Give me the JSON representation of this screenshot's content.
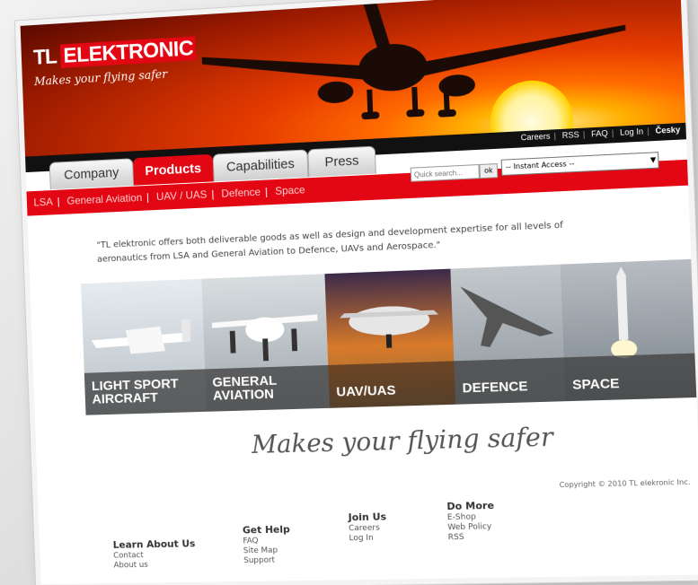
{
  "brand": {
    "logo_tl": "TL",
    "logo_name": "ELEKTRONIC",
    "tagline": "Makes your flying safer"
  },
  "utility_links": [
    "Careers",
    "RSS",
    "FAQ",
    "Log In",
    "Česky"
  ],
  "tabs": [
    {
      "label": "Company",
      "active": false
    },
    {
      "label": "Products",
      "active": true
    },
    {
      "label": "Capabilities",
      "active": false
    },
    {
      "label": "Press",
      "active": false
    }
  ],
  "subnav": [
    "LSA",
    "General Aviation",
    "UAV / UAS",
    "Defence",
    "Space"
  ],
  "search": {
    "placeholder": "Quick search...",
    "button": "ok"
  },
  "instant_access": {
    "value": "-- Instant Access --"
  },
  "intro": "\"TL elektronic offers both deliverable goods as well as design and development expertise for all levels of aeronautics from LSA and General Aviation to Defence, UAVs and Aerospace.\"",
  "tiles": [
    {
      "label": "LIGHT SPORT AIRCRAFT"
    },
    {
      "label": "GENERAL AVIATION"
    },
    {
      "label": "UAV/UAS"
    },
    {
      "label": "DEFENCE"
    },
    {
      "label": "SPACE"
    }
  ],
  "slogan": "Makes your flying safer",
  "copyright": "Copyright © 2010 TL elekronic Inc.",
  "footer": [
    {
      "heading": "Learn About Us",
      "items": [
        "Contact",
        "About us"
      ]
    },
    {
      "heading": "Get Help",
      "items": [
        "FAQ",
        "Site Map",
        "Support"
      ]
    },
    {
      "heading": "Join Us",
      "items": [
        "Careers",
        "Log In"
      ]
    },
    {
      "heading": "Do More",
      "items": [
        "E-Shop",
        "Web Policy",
        "RSS"
      ]
    }
  ],
  "colors": {
    "brand_red": "#e30613",
    "bar_black": "#111111"
  }
}
